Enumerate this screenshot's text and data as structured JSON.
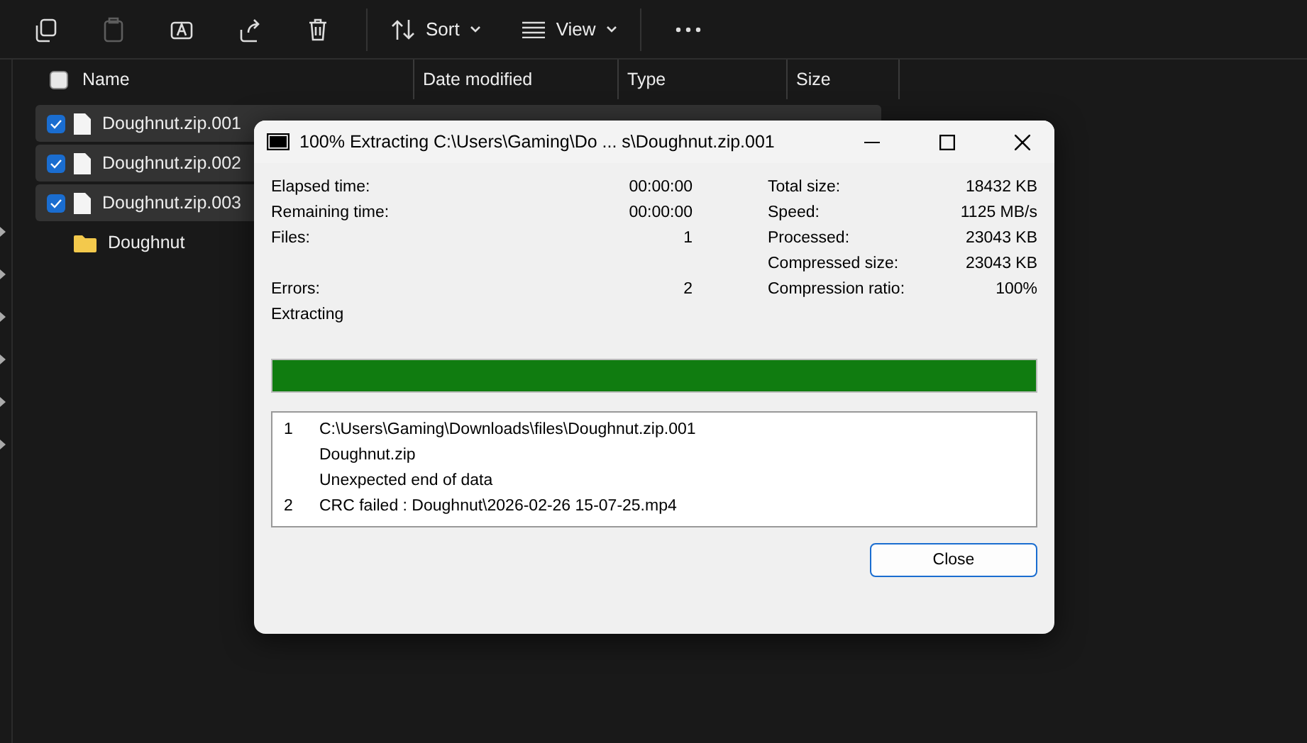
{
  "toolbar": {
    "sort": "Sort",
    "view": "View"
  },
  "columns": [
    "Name",
    "Date modified",
    "Type",
    "Size"
  ],
  "header_checkbox": {
    "checked": false
  },
  "files": [
    {
      "name": "Doughnut.zip.001",
      "kind": "file",
      "selected": true
    },
    {
      "name": "Doughnut.zip.002",
      "kind": "file",
      "selected": true
    },
    {
      "name": "Doughnut.zip.003",
      "kind": "file",
      "selected": true
    },
    {
      "name": "Doughnut",
      "kind": "folder",
      "selected": false
    }
  ],
  "dialog": {
    "title": "100% Extracting C:\\Users\\Gaming\\Do ... s\\Doughnut.zip.001",
    "stats": [
      {
        "left_label": "Elapsed time:",
        "left_value": "00:00:00",
        "right_label": "Total size:",
        "right_value": "18432 KB"
      },
      {
        "left_label": "Remaining time:",
        "left_value": "00:00:00",
        "right_label": "Speed:",
        "right_value": "1125 MB/s"
      },
      {
        "left_label": "Files:",
        "left_value": "1",
        "right_label": "Processed:",
        "right_value": "23043 KB"
      },
      {
        "right_label": "Compressed size:",
        "right_value": "23043 KB"
      },
      {
        "left_label": "Errors:",
        "left_value": "2",
        "right_label": "Compression ratio:",
        "right_value": "100%"
      }
    ],
    "status": "Extracting",
    "progress": {
      "level": 1
    },
    "log": [
      {
        "number": "1",
        "text": "C:\\Users\\Gaming\\Downloads\\files\\Doughnut.zip.001"
      },
      {
        "text": "Doughnut.zip"
      },
      {
        "text": "Unexpected end of data"
      },
      {
        "number": "2",
        "text": "CRC failed : Doughnut\\2026-02-26 15-07-25.mp4"
      }
    ],
    "close_button": "Close"
  }
}
